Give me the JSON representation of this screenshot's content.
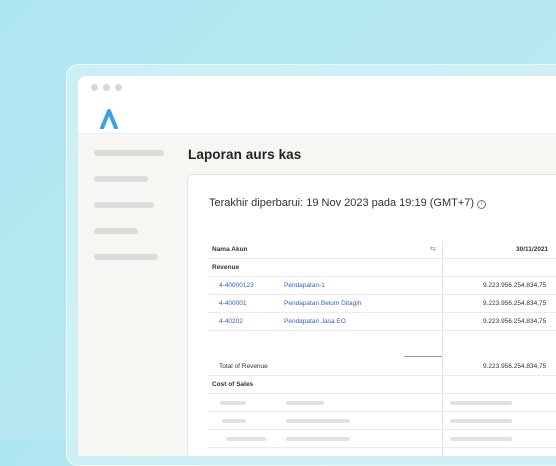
{
  "app": {
    "logo": "app-logo-a"
  },
  "page": {
    "title": "Laporan aurs kas"
  },
  "report": {
    "last_updated": "Terakhir diperbarui: 19 Nov 2023 pada 19:19 (GMT+7)",
    "info_icon": "info-icon",
    "table": {
      "col_account": "Nama Akun",
      "col_date": "30/11/2021",
      "sections": {
        "revenue": "Revenue",
        "total_revenue": "Total of Revenue",
        "cost_of_sales": "Cost of Sales"
      },
      "rows": [
        {
          "code": "4-40000123",
          "name": "Pendapatan-1",
          "value": "9.223.956.254.834,75"
        },
        {
          "code": "4-400001",
          "name": "Pendapatan Belum Ditagih",
          "value": "9.223.956.254.834,75"
        },
        {
          "code": "4-40202",
          "name": "Pendapatan Jasa EO",
          "value": "9.223.956.254.834,75"
        }
      ],
      "total_value": "9.223.956.254.834,75"
    }
  },
  "colors": {
    "accent": "#3aa0e6",
    "link": "#3a5bc7"
  }
}
